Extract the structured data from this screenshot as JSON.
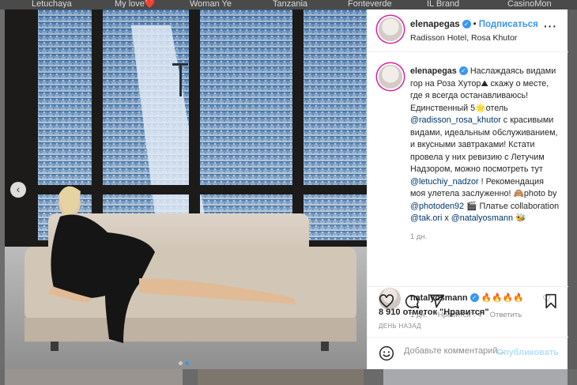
{
  "background": {
    "tabs": [
      "Letuchaya",
      "My love❤️",
      "Woman Ye",
      "Tanzania",
      "Fonteverde",
      "IL Brand",
      "CasinoMon"
    ]
  },
  "post": {
    "username": "elenapegas",
    "follow_label": "Подписаться",
    "separator": "•",
    "location": "Radisson Hotel, Rosa Khutor",
    "more_icon": "more-horizontal-icon",
    "caption": {
      "username": "elenapegas",
      "t1": " Наслаждаясь видами гор на Роза Хутор⛰ скажу о месте, где я всегда останавливаюсь! Единственный 5🌟отель ",
      "m1": "@radisson_rosa_khutor",
      "t2": " с красивыми видами, идеальным обслуживанием, и вкусными завтраками! Кстати провела у них ревизию с Летучим Надзором, можно посмотреть тут ",
      "m2": "@letuchiy_nadzor",
      "t3": " ! Рекомендация моя улетела заслуженно! 🙈photo by ",
      "m3": "@photoden92",
      "t4": " 🎬 Платье collaboration ",
      "m4": "@tak.ori",
      "t5": " x ",
      "m5": "@natalyosmann",
      "t6": " 🐝",
      "time": "1 дн."
    },
    "comment": {
      "username": "natalyosmann",
      "text": "🔥🔥🔥🔥",
      "time": "1 дн.",
      "likes": "\"Нравится\": 4",
      "reply": "Ответить"
    },
    "likes_text": "8 910 отметок \"Нравится\"",
    "date_text": "ДЕНЬ НАЗАД",
    "comment_placeholder": "Добавьте комментарий...",
    "publish_label": "Опубликовать",
    "carousel": {
      "current": 2,
      "total": 2
    }
  },
  "icons": {
    "like": "heart-icon",
    "comment": "comment-icon",
    "share": "share-icon",
    "save": "bookmark-icon",
    "emoji": "smiley-icon",
    "prev": "chevron-left-icon"
  },
  "colors": {
    "link": "#3897f0",
    "mention": "#00376b",
    "muted": "#8e8e8e"
  }
}
